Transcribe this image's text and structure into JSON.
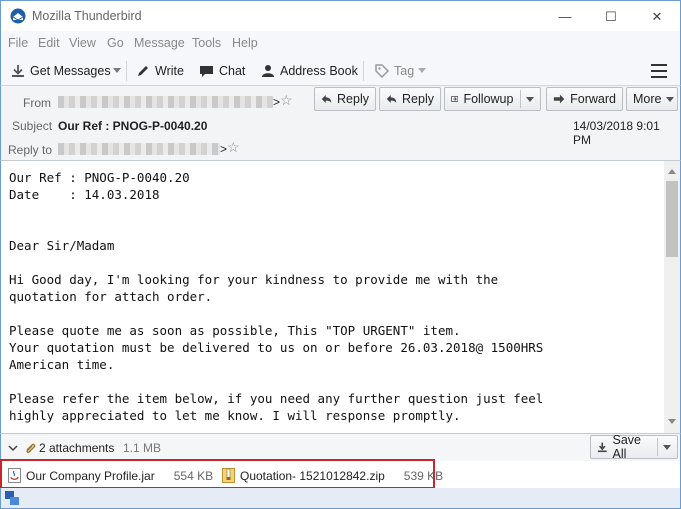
{
  "window": {
    "title": "Mozilla Thunderbird",
    "controls": {
      "minimize": "—",
      "maximize": "☐",
      "close": "✕"
    }
  },
  "menu": [
    "File",
    "Edit",
    "View",
    "Go",
    "Message",
    "Tools",
    "Help"
  ],
  "toolbar": {
    "get_messages": "Get Messages",
    "write": "Write",
    "chat": "Chat",
    "address_book": "Address Book",
    "tag": "Tag"
  },
  "header": {
    "from_label": "From",
    "subject_label": "Subject",
    "reply_to_label": "Reply to",
    "subject": "Our Ref : PNOG-P-0040.20",
    "date": "14/03/2018 9:01 PM",
    "from_suffix": ">",
    "reply_to_suffix": ">",
    "buttons": {
      "reply": "Reply",
      "reply2": "Reply",
      "followup": "Followup",
      "forward": "Forward",
      "more": "More"
    }
  },
  "message_body": "Our Ref : PNOG-P-0040.20\nDate    : 14.03.2018\n\n\nDear Sir/Madam\n\nHi Good day, I'm looking for your kindness to provide me with the\nquotation for attach order.\n\nPlease quote me as soon as possible, This \"TOP URGENT\" item.\nYour quotation must be delivered to us on or before 26.03.2018@ 1500HRS\nAmerican time.\n\nPlease refer the item below, if you need any further question just feel\nhighly appreciated to let me know. I will response promptly.",
  "attachments": {
    "summary": "2 attachments",
    "total_size": "1.1 MB",
    "save_all": "Save All",
    "files": [
      {
        "name": "Our Company Profile.jar",
        "size": "554 KB",
        "icon": "java-file-icon"
      },
      {
        "name": "Quotation- 1521012842.zip",
        "size": "539 KB",
        "icon": "zip-file-icon"
      }
    ]
  },
  "colors": {
    "alert_outline": "#c8262c",
    "window_border": "#6b9ccf"
  }
}
